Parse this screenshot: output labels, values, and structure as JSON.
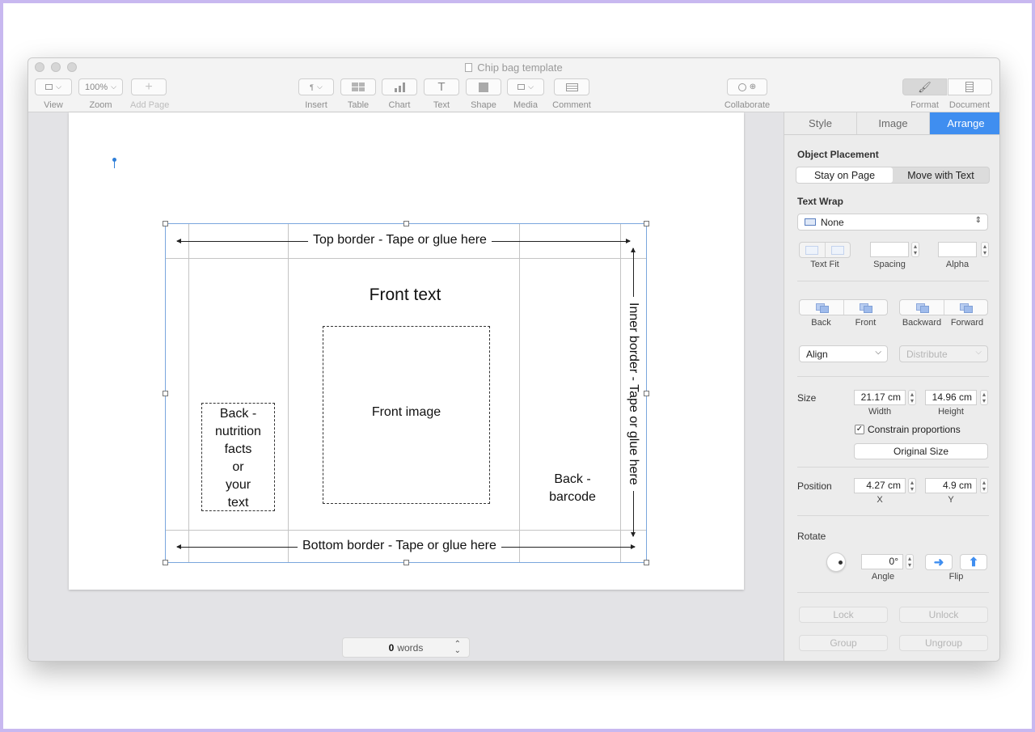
{
  "window": {
    "title": "Chip bag template"
  },
  "toolbar": {
    "view": {
      "label": "View"
    },
    "zoom": {
      "label": "Zoom",
      "value": "100%"
    },
    "add_page": {
      "label": "Add Page"
    },
    "insert": {
      "label": "Insert"
    },
    "table": {
      "label": "Table"
    },
    "chart": {
      "label": "Chart"
    },
    "text": {
      "label": "Text"
    },
    "shape": {
      "label": "Shape"
    },
    "media": {
      "label": "Media"
    },
    "comment": {
      "label": "Comment"
    },
    "collaborate": {
      "label": "Collaborate"
    },
    "format": {
      "label": "Format"
    },
    "document": {
      "label": "Document"
    }
  },
  "template": {
    "top_border": "Top border - Tape or glue here",
    "bottom_border": "Bottom border - Tape or glue here",
    "inner_border": "Inner border - Tape or glue here",
    "front_text": "Front text",
    "front_image": "Front image",
    "back_nutrition": [
      "Back -",
      "nutrition",
      "facts",
      "or",
      "your",
      "text"
    ],
    "back_barcode": [
      "Back -",
      "barcode"
    ]
  },
  "status": {
    "word_count": "0",
    "words_label": "words"
  },
  "inspector": {
    "tabs": [
      "Style",
      "Image",
      "Arrange"
    ],
    "active_tab": "Arrange",
    "object_placement": {
      "title": "Object Placement",
      "options": [
        "Stay on Page",
        "Move with Text"
      ],
      "selected": "Stay on Page"
    },
    "text_wrap": {
      "title": "Text Wrap",
      "value": "None",
      "text_fit_label": "Text Fit",
      "spacing_label": "Spacing",
      "alpha_label": "Alpha"
    },
    "arrange": {
      "back_label": "Back",
      "front_label": "Front",
      "backward_label": "Backward",
      "forward_label": "Forward"
    },
    "align": {
      "value": "Align",
      "distribute": "Distribute"
    },
    "size": {
      "title": "Size",
      "width": "21.17 cm",
      "width_label": "Width",
      "height": "14.96 cm",
      "height_label": "Height",
      "constrain_label": "Constrain proportions",
      "constrain_checked": true,
      "original_size": "Original Size"
    },
    "position": {
      "title": "Position",
      "x": "4.27 cm",
      "x_label": "X",
      "y": "4.9 cm",
      "y_label": "Y"
    },
    "rotate": {
      "title": "Rotate",
      "angle": "0°",
      "angle_label": "Angle",
      "flip_label": "Flip"
    },
    "lock": "Lock",
    "unlock": "Unlock",
    "group": "Group",
    "ungroup": "Ungroup"
  },
  "colors": {
    "accent": "#3f8ef0",
    "frame": "#c8b8f0"
  }
}
